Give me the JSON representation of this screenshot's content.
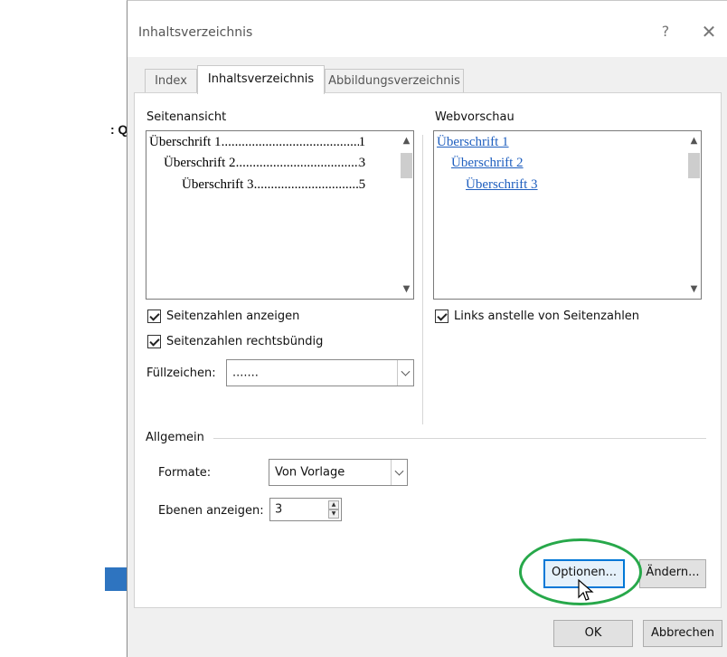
{
  "background": {
    "fragment_text": ": Q",
    "arrow_color": "#2e74c0"
  },
  "dialog": {
    "title": "Inhaltsverzeichnis",
    "help_label": "?",
    "close_label": "✕",
    "tabs": [
      {
        "label": "Index",
        "active": false
      },
      {
        "label": "Inhaltsverzeichnis",
        "active": true
      },
      {
        "label": "Abbildungsverzeichnis",
        "active": false
      }
    ]
  },
  "print_preview": {
    "label": "Seitenansicht",
    "lines": [
      {
        "text": "Überschrift 1",
        "page": "1"
      },
      {
        "text": "Überschrift 2",
        "page": "3"
      },
      {
        "text": "Überschrift 3",
        "page": "5"
      }
    ]
  },
  "web_preview": {
    "label": "Webvorschau",
    "links": [
      "Überschrift 1",
      "Überschrift 2",
      "Überschrift 3"
    ],
    "link_color": "#1f5fbf"
  },
  "options": {
    "show_page_numbers": {
      "label": "Seitenzahlen anzeigen",
      "checked": true
    },
    "right_align": {
      "label": "Seitenzahlen rechtsbündig",
      "checked": true
    },
    "links_instead": {
      "label": "Links anstelle von Seitenzahlen",
      "checked": true
    },
    "tab_leader": {
      "label": "Füllzeichen:",
      "value": "......."
    }
  },
  "general": {
    "group_label": "Allgemein",
    "formats": {
      "label": "Formate:",
      "value": "Von Vorlage"
    },
    "levels": {
      "label": "Ebenen anzeigen:",
      "value": "3"
    }
  },
  "buttons": {
    "options": "Optionen...",
    "modify": "Ändern...",
    "ok": "OK",
    "cancel": "Abbrechen"
  },
  "annotation": {
    "ring_color": "#27a84a"
  },
  "icons": {
    "scroll_up": "scroll-up-icon",
    "scroll_down": "scroll-down-icon",
    "dropdown": "chevron-down-icon",
    "spin_up": "spin-up-icon",
    "spin_down": "spin-down-icon",
    "cursor": "mouse-pointer-icon",
    "arrow": "arrow-right-icon"
  }
}
